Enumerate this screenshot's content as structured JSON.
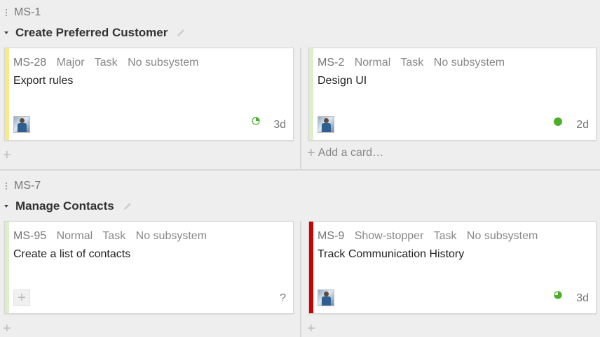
{
  "swimlanes": [
    {
      "key": "MS-1",
      "title": "Create Preferred Customer",
      "cards": [
        {
          "id": "MS-28",
          "priority": "Major",
          "type": "Task",
          "subsystem": "No subsystem",
          "summary": "Export rules",
          "estimate": "3d",
          "stripe_color": "#f9e98a",
          "status_icon": "progress-pie-icon",
          "assignee": "user-avatar"
        },
        {
          "id": "MS-2",
          "priority": "Normal",
          "type": "Task",
          "subsystem": "No subsystem",
          "summary": "Design UI",
          "estimate": "2d",
          "stripe_color": "#dcefc8",
          "status_icon": "status-dot-green-icon",
          "assignee": "user-avatar"
        }
      ],
      "add_card_label": "Add a card…"
    },
    {
      "key": "MS-7",
      "title": "Manage Contacts",
      "cards": [
        {
          "id": "MS-95",
          "priority": "Normal",
          "type": "Task",
          "subsystem": "No subsystem",
          "summary": "Create a list of contacts",
          "estimate": "?",
          "stripe_color": "#dcefc8",
          "status_icon": "",
          "assignee": "add-assignee"
        },
        {
          "id": "MS-9",
          "priority": "Show-stopper",
          "type": "Task",
          "subsystem": "No subsystem",
          "summary": "Track Communication History",
          "estimate": "3d",
          "stripe_color": "#cc0000",
          "status_icon": "progress-pie-icon",
          "assignee": "user-avatar"
        }
      ]
    }
  ],
  "colors": {
    "accent_green": "#4caf2a",
    "show_stopper_red": "#cc0000",
    "major_yellow": "#f9e98a",
    "normal_green": "#dcefc8"
  }
}
